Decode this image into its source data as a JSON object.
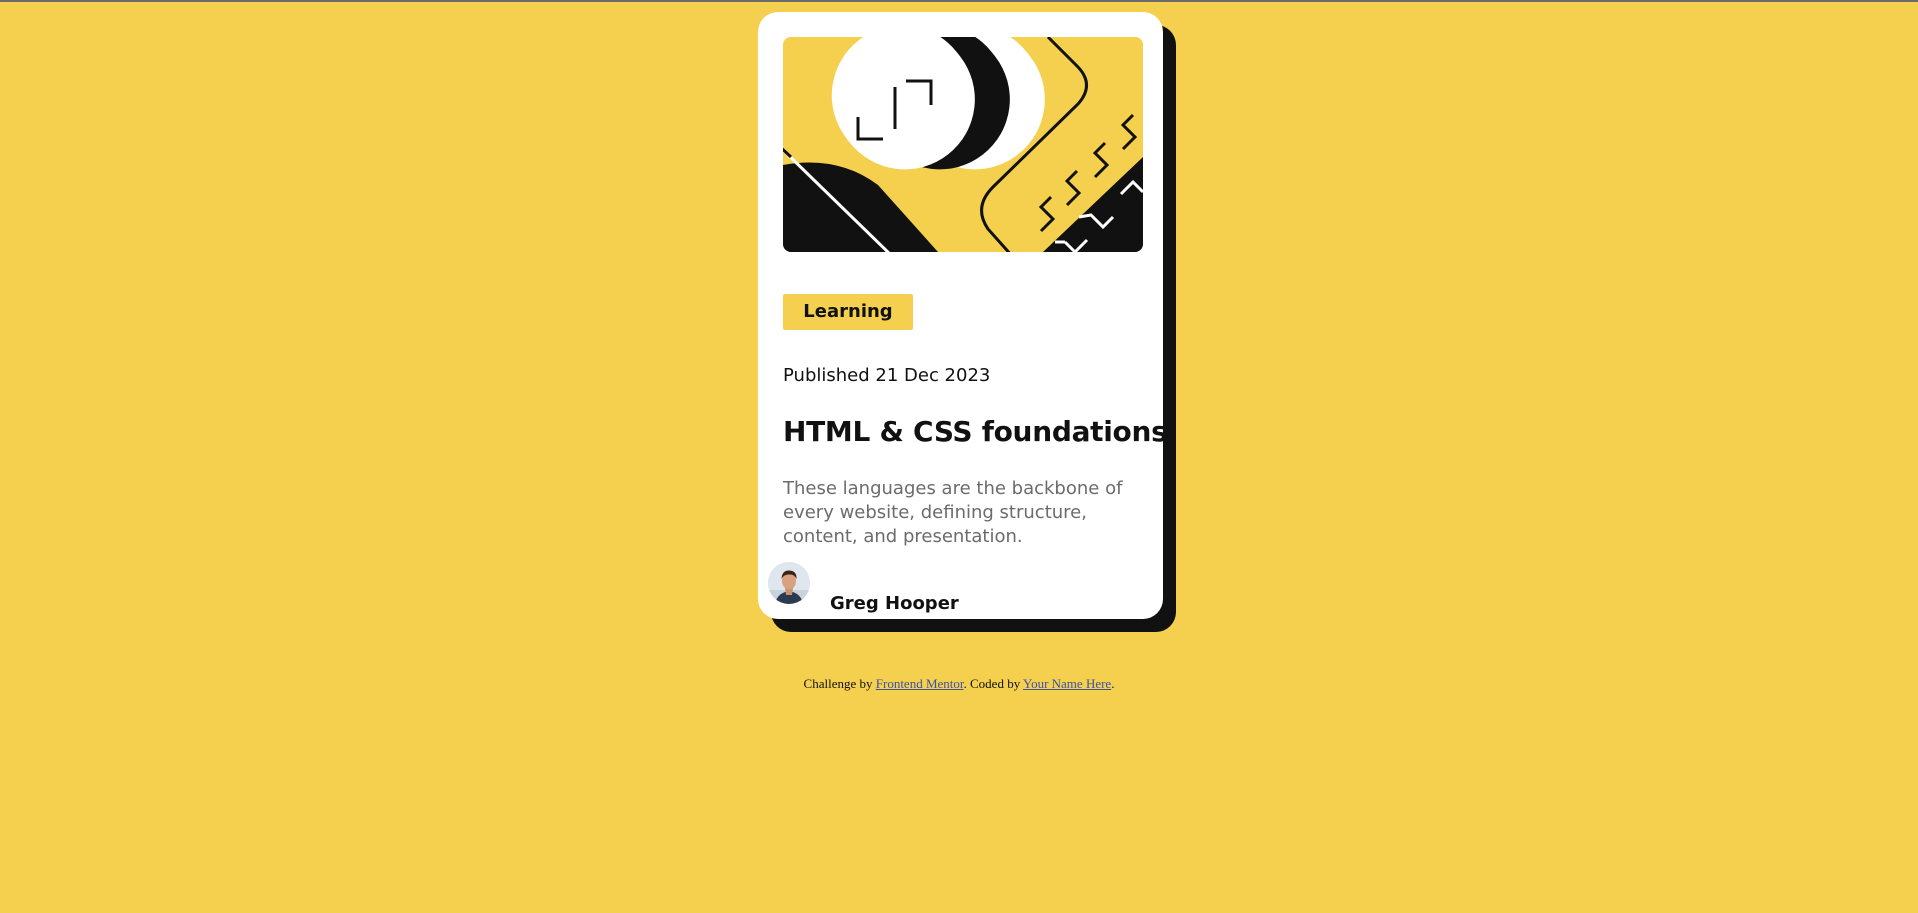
{
  "colors": {
    "background": "#F4D04E",
    "card": "#FFFFFF",
    "shadow": "#111111",
    "text_primary": "#111111",
    "text_secondary": "#6B6B6B",
    "link": "#3E52A3"
  },
  "card": {
    "illustration_icon": "abstract-illustration-icon",
    "category": "Learning",
    "published": "Published 21 Dec 2023",
    "title": "HTML & CSS foundations",
    "description": "These languages are the backbone of every website, defining structure, content, and presentation.",
    "author": {
      "avatar_icon": "avatar-icon",
      "name": "Greg Hooper"
    }
  },
  "attribution": {
    "prefix": "Challenge by ",
    "link1": "Frontend Mentor",
    "middle": ". Coded by ",
    "link2": "Your Name Here",
    "suffix": "."
  }
}
